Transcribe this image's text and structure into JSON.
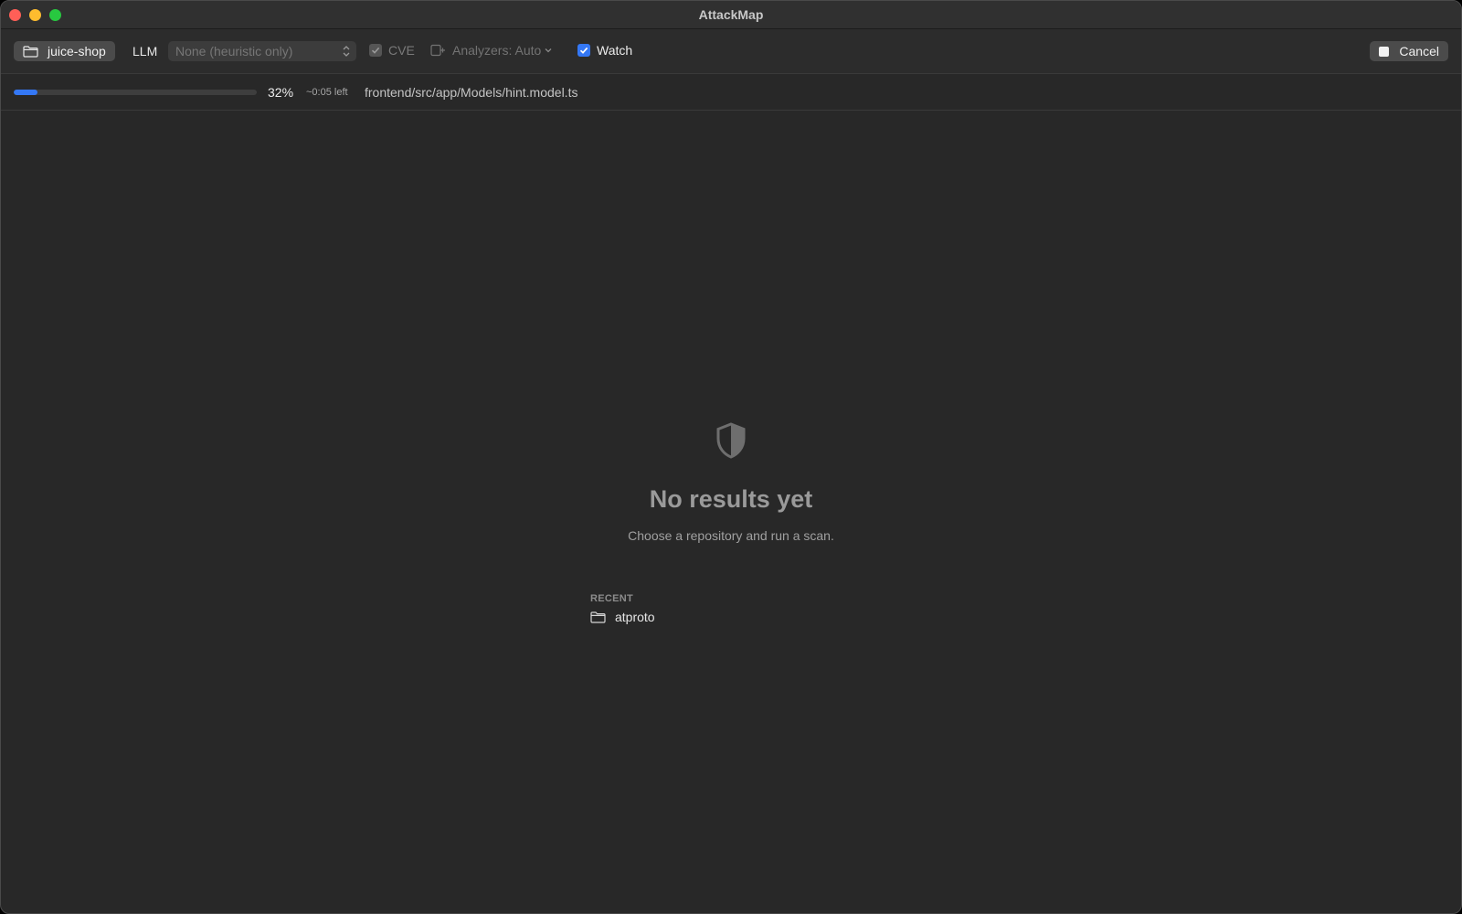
{
  "window": {
    "title": "AttackMap",
    "colors": {
      "background": "#282828",
      "accent": "#3478f6",
      "close": "#ff5f57",
      "minimize": "#febc2e",
      "maximize": "#28c840"
    }
  },
  "toolbar": {
    "repo_label": "juice-shop",
    "llm_label": "LLM",
    "llm_selected": "None (heuristic only)",
    "cve_label": "CVE",
    "cve_checked": true,
    "cve_enabled": false,
    "analyzers_label": "Analyzers: Auto",
    "watch_label": "Watch",
    "watch_checked": true,
    "cancel_label": "Cancel"
  },
  "progress": {
    "percent": 32,
    "percent_label": "32%",
    "eta": "~0:05 left",
    "current_file": "frontend/src/app/Models/hint.model.ts"
  },
  "empty_state": {
    "icon": "shield-icon",
    "title": "No results yet",
    "subtitle": "Choose a repository and run a scan."
  },
  "recent": {
    "heading": "RECENT",
    "items": [
      {
        "label": "atproto",
        "icon": "folder-icon"
      }
    ]
  }
}
